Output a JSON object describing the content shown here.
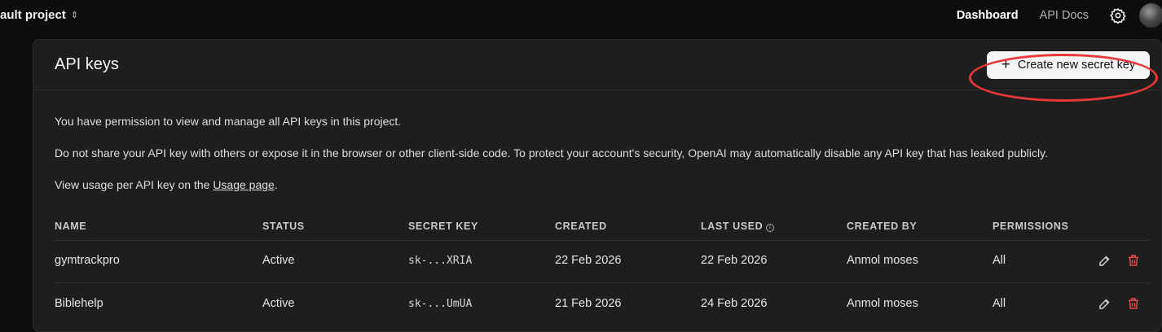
{
  "header": {
    "project_name": "ault project",
    "nav": {
      "dashboard": "Dashboard",
      "api_docs": "API Docs"
    }
  },
  "panel": {
    "title": "API keys",
    "create_button": "Create new secret key",
    "info_lines": {
      "permission": "You have permission to view and manage all API keys in this project.",
      "warning": "Do not share your API key with others or expose it in the browser or other client-side code. To protect your account's security, OpenAI may automatically disable any API key that has leaked publicly.",
      "usage_prefix": "View usage per API key on the ",
      "usage_link": "Usage page",
      "usage_suffix": "."
    }
  },
  "table": {
    "columns": [
      "NAME",
      "STATUS",
      "SECRET KEY",
      "CREATED",
      "LAST USED",
      "CREATED BY",
      "PERMISSIONS"
    ],
    "rows": [
      {
        "name": "gymtrackpro",
        "status": "Active",
        "secret_key": "sk-...XRIA",
        "created": "22 Feb 2026",
        "last_used": "22 Feb 2026",
        "created_by": "Anmol moses",
        "permissions": "All"
      },
      {
        "name": "Biblehelp",
        "status": "Active",
        "secret_key": "sk-...UmUA",
        "created": "21 Feb 2026",
        "last_used": "24 Feb 2026",
        "created_by": "Anmol moses",
        "permissions": "All"
      }
    ]
  },
  "colors": {
    "background": "#0d0d0d",
    "panel": "#1e1e1e",
    "highlight_ring": "#e83838",
    "delete_icon": "#e5484d"
  },
  "icons": {
    "project_switcher": "chevron-up-down-icon",
    "settings": "gear-icon",
    "edit": "pencil-icon",
    "delete": "trash-icon",
    "info": "info-icon",
    "plus": "plus-icon"
  }
}
